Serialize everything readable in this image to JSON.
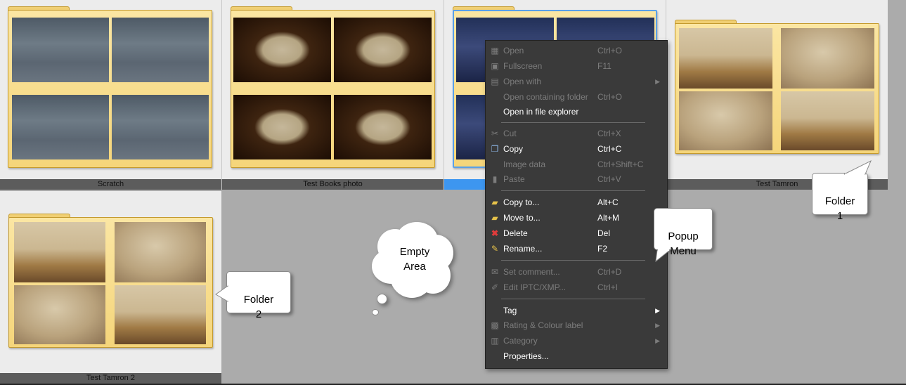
{
  "tiles": [
    {
      "caption": "Scratch"
    },
    {
      "caption": "Test Books photo"
    },
    {
      "caption": ""
    },
    {
      "caption": "Test Tamron"
    },
    {
      "caption": "Test Tamron 2"
    }
  ],
  "menu": {
    "items": [
      {
        "label": "Open",
        "shortcut": "Ctrl+O",
        "icon": "open-icon",
        "enabled": false
      },
      {
        "label": "Fullscreen",
        "shortcut": "F11",
        "icon": "fullscreen-icon",
        "enabled": false
      },
      {
        "label": "Open with",
        "shortcut": "",
        "icon": "open-with-icon",
        "enabled": false,
        "submenu": true
      },
      {
        "label": "Open containing folder",
        "shortcut": "Ctrl+O",
        "icon": "",
        "enabled": false
      },
      {
        "label": "Open in file explorer",
        "shortcut": "",
        "icon": "",
        "enabled": true
      },
      {
        "label": "Cut",
        "shortcut": "Ctrl+X",
        "icon": "scissors-icon",
        "enabled": false
      },
      {
        "label": "Copy",
        "shortcut": "Ctrl+C",
        "icon": "copy-icon",
        "enabled": true
      },
      {
        "label": "Image data",
        "shortcut": "Ctrl+Shift+C",
        "icon": "",
        "enabled": false
      },
      {
        "label": "Paste",
        "shortcut": "Ctrl+V",
        "icon": "paste-icon",
        "enabled": false
      },
      {
        "label": "Copy to...",
        "shortcut": "Alt+C",
        "icon": "copy-to-icon",
        "enabled": true
      },
      {
        "label": "Move to...",
        "shortcut": "Alt+M",
        "icon": "move-to-icon",
        "enabled": true
      },
      {
        "label": "Delete",
        "shortcut": "Del",
        "icon": "delete-icon",
        "enabled": true
      },
      {
        "label": "Rename...",
        "shortcut": "F2",
        "icon": "rename-icon",
        "enabled": true
      },
      {
        "label": "Set comment...",
        "shortcut": "Ctrl+D",
        "icon": "comment-icon",
        "enabled": false
      },
      {
        "label": "Edit IPTC/XMP...",
        "shortcut": "Ctrl+I",
        "icon": "iptc-icon",
        "enabled": false
      },
      {
        "label": "Tag",
        "shortcut": "",
        "icon": "",
        "enabled": true,
        "submenu": true
      },
      {
        "label": "Rating & Colour label",
        "shortcut": "",
        "icon": "rating-icon",
        "enabled": false,
        "submenu": true
      },
      {
        "label": "Category",
        "shortcut": "",
        "icon": "category-icon",
        "enabled": false,
        "submenu": true
      },
      {
        "label": "Properties...",
        "shortcut": "",
        "icon": "",
        "enabled": true
      }
    ]
  },
  "callouts": {
    "folder1": "Folder\n1",
    "popup": "Popup\nMenu",
    "folder2": "Folder\n2",
    "empty": "Empty\nArea"
  },
  "colors": {
    "background": "#ababab",
    "tile_bg": "#ececec",
    "caption_bg": "#5c5c5c",
    "selected_caption": "#3d96f0",
    "menu_bg": "#3a3a3a",
    "folder_yellow": "#f5d57a"
  }
}
